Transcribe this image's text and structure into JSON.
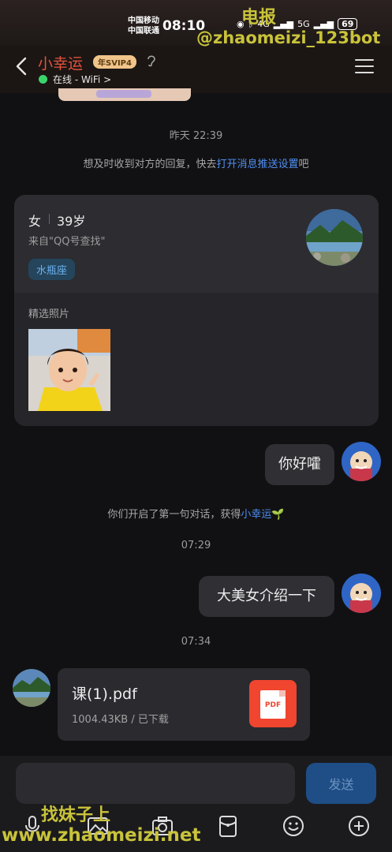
{
  "status_bar": {
    "carrier_line1": "中国移动",
    "carrier_line2": "中国联通",
    "time": "08:10",
    "network1": "4G",
    "network2": "5G",
    "battery": "69"
  },
  "watermark": {
    "top_label": "电报",
    "handle": "@zhaomeizi_123bot",
    "bottom_label": "找妹子上",
    "bottom_url": "www.zhaomeizi.net"
  },
  "header": {
    "title": "小幸运",
    "vip_badge": "年SVIP4",
    "presence": "在线 - WiFi",
    "presence_chevron": ">",
    "presence_color": "#3ad46b",
    "title_color": "#e2533e"
  },
  "timeline": {
    "ts1": "昨天 22:39",
    "notice_prefix": "想及时收到对方的回复，快去",
    "notice_link": "打开消息推送设置",
    "notice_suffix": "吧",
    "ts2": "07:29",
    "ts3": "07:34"
  },
  "profile_card": {
    "gender": "女",
    "age": "39岁",
    "source": "来自\"QQ号查找\"",
    "zodiac": "水瓶座",
    "photos_label": "精选照片"
  },
  "messages": {
    "m1": "你好嚯",
    "first_chat_prefix": "你们开启了第一句对话，获得",
    "first_chat_link": "小幸运",
    "m2": "大美女介绍一下"
  },
  "file": {
    "name": "课(1).pdf",
    "meta": "1004.43KB / 已下载",
    "icon_label": "PDF"
  },
  "composer": {
    "placeholder": "",
    "send_label": "发送"
  },
  "colors": {
    "accent_link": "#4f8ff0",
    "pdf_red": "#f0452f",
    "send_bg": "#1f4e86"
  }
}
